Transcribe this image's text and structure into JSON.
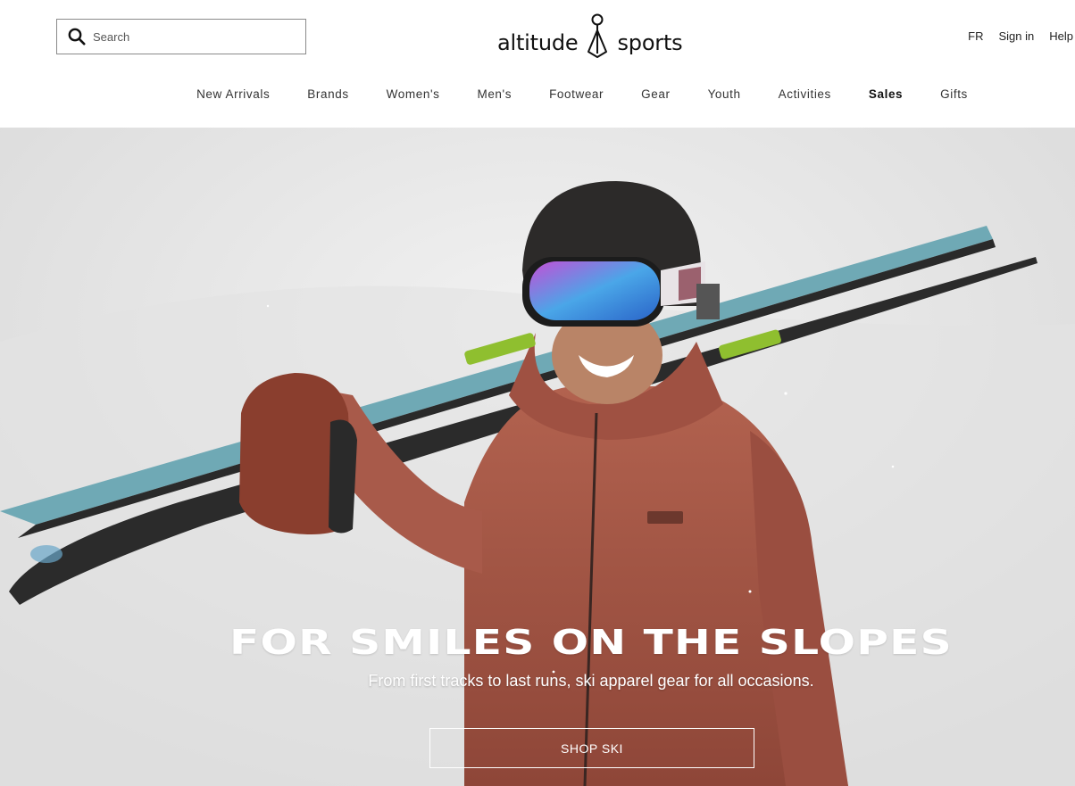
{
  "header": {
    "search": {
      "placeholder": "Search"
    },
    "logo": {
      "left_word": "altitude",
      "right_word": "sports"
    },
    "util_links": [
      "FR",
      "Sign in",
      "Help"
    ]
  },
  "nav": {
    "items": [
      {
        "label": "New Arrivals",
        "bold": false
      },
      {
        "label": "Brands",
        "bold": false
      },
      {
        "label": "Women's",
        "bold": false
      },
      {
        "label": "Men's",
        "bold": false
      },
      {
        "label": "Footwear",
        "bold": false
      },
      {
        "label": "Gear",
        "bold": false
      },
      {
        "label": "Youth",
        "bold": false
      },
      {
        "label": "Activities",
        "bold": false
      },
      {
        "label": "Sales",
        "bold": true
      },
      {
        "label": "Gifts",
        "bold": false
      }
    ]
  },
  "hero": {
    "title": "FOR SMILES ON THE SLOPES",
    "subtitle": "From first tracks to last runs, ski apparel gear for all occasions.",
    "cta_label": "SHOP SKI",
    "image_alt": "Smiling skier in a rust-red jacket, black helmet and mirrored goggles carrying skis on her shoulder in snow"
  },
  "colors": {
    "jacket": "#a5574a",
    "snow": "#e6e6e6",
    "ski_top": "#6fa9b5",
    "ski_base": "#2a2a2a"
  }
}
